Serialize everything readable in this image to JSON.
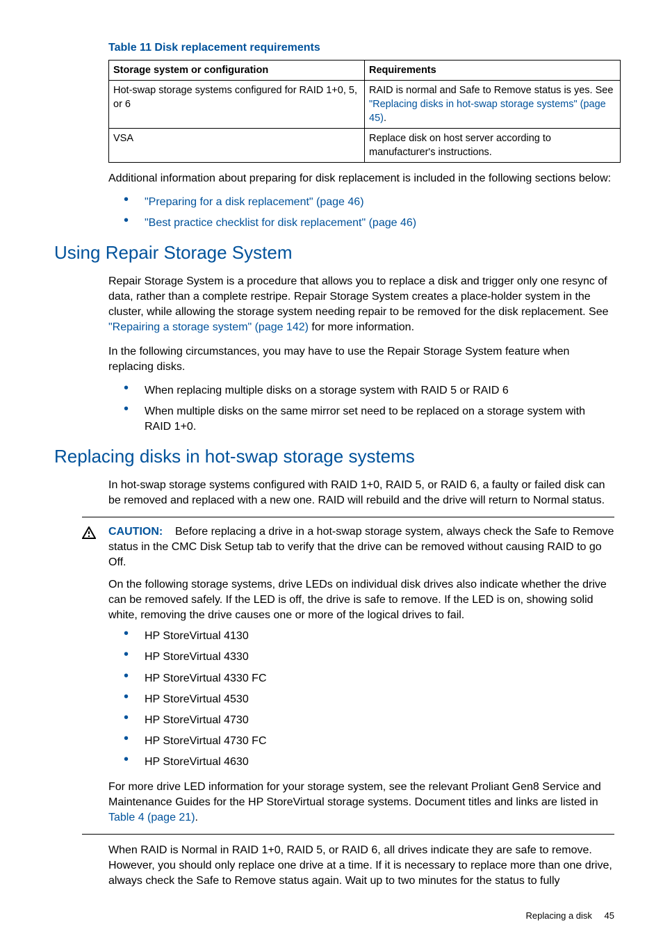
{
  "table": {
    "title": "Table 11 Disk replacement requirements",
    "headers": [
      "Storage system or configuration",
      "Requirements"
    ],
    "rows": [
      {
        "c0": "Hot-swap storage systems configured for RAID 1+0, 5, or 6",
        "c1_pre": "RAID is normal and Safe to Remove status is yes. See ",
        "c1_link": "\"Replacing disks in hot-swap storage systems\" (page 45)",
        "c1_post": "."
      },
      {
        "c0": "VSA",
        "c1": "Replace disk on host server according to manufacturer's instructions."
      }
    ]
  },
  "intro": "Additional information about preparing for disk replacement is included in the following sections below:",
  "intro_links": [
    "\"Preparing for a disk replacement\" (page 46)",
    "\"Best practice checklist for disk replacement\" (page 46)"
  ],
  "sec1": {
    "title": "Using Repair Storage System",
    "p1_pre": "Repair Storage System is a procedure that allows you to replace a disk and trigger only one resync of data, rather than a complete restripe. Repair Storage System creates a place-holder system in the cluster, while allowing the storage system needing repair to be removed for the disk replacement. See ",
    "p1_link": "\"Repairing a storage system\" (page 142)",
    "p1_post": " for more information.",
    "p2": "In the following circumstances, you may have to use the Repair Storage System feature when replacing disks.",
    "bullets": [
      "When replacing multiple disks on a storage system with RAID 5 or RAID 6",
      "When multiple disks on the same mirror set need to be replaced on a storage system with RAID 1+0."
    ]
  },
  "sec2": {
    "title": "Replacing disks in hot-swap storage systems",
    "p1": "In hot-swap storage systems configured with RAID 1+0, RAID 5, or RAID 6, a faulty or failed disk can be removed and replaced with a new one. RAID will rebuild and the drive will return to Normal status.",
    "caution_label": "CAUTION:",
    "caution_p1": "Before replacing a drive in a hot-swap storage system, always check the Safe to Remove status in the CMC Disk Setup tab to verify that the drive can be removed without causing RAID to go Off.",
    "caution_p2": "On the following storage systems, drive LEDs on individual disk drives also indicate whether the drive can be removed safely. If the LED is off, the drive is safe to remove. If the LED is on, showing solid white, removing the drive causes one or more of the logical drives to fail.",
    "models": [
      "HP StoreVirtual 4130",
      "HP StoreVirtual 4330",
      "HP StoreVirtual 4330 FC",
      "HP StoreVirtual 4530",
      "HP StoreVirtual 4730",
      "HP StoreVirtual 4730 FC",
      "HP StoreVirtual 4630"
    ],
    "caution_p3_pre": "For more drive LED information for your storage system, see the relevant Proliant Gen8 Service and Maintenance Guides for the HP StoreVirtual storage systems. Document titles and links are listed in ",
    "caution_p3_link": "Table 4 (page 21)",
    "caution_p3_post": ".",
    "p2": "When RAID is Normal in RAID 1+0, RAID 5, or RAID 6, all drives indicate they are safe to remove. However, you should only replace one drive at a time. If it is necessary to replace more than one drive, always check the Safe to Remove status again. Wait up to two minutes for the status to fully"
  },
  "footer": {
    "label": "Replacing a disk",
    "page": "45"
  }
}
